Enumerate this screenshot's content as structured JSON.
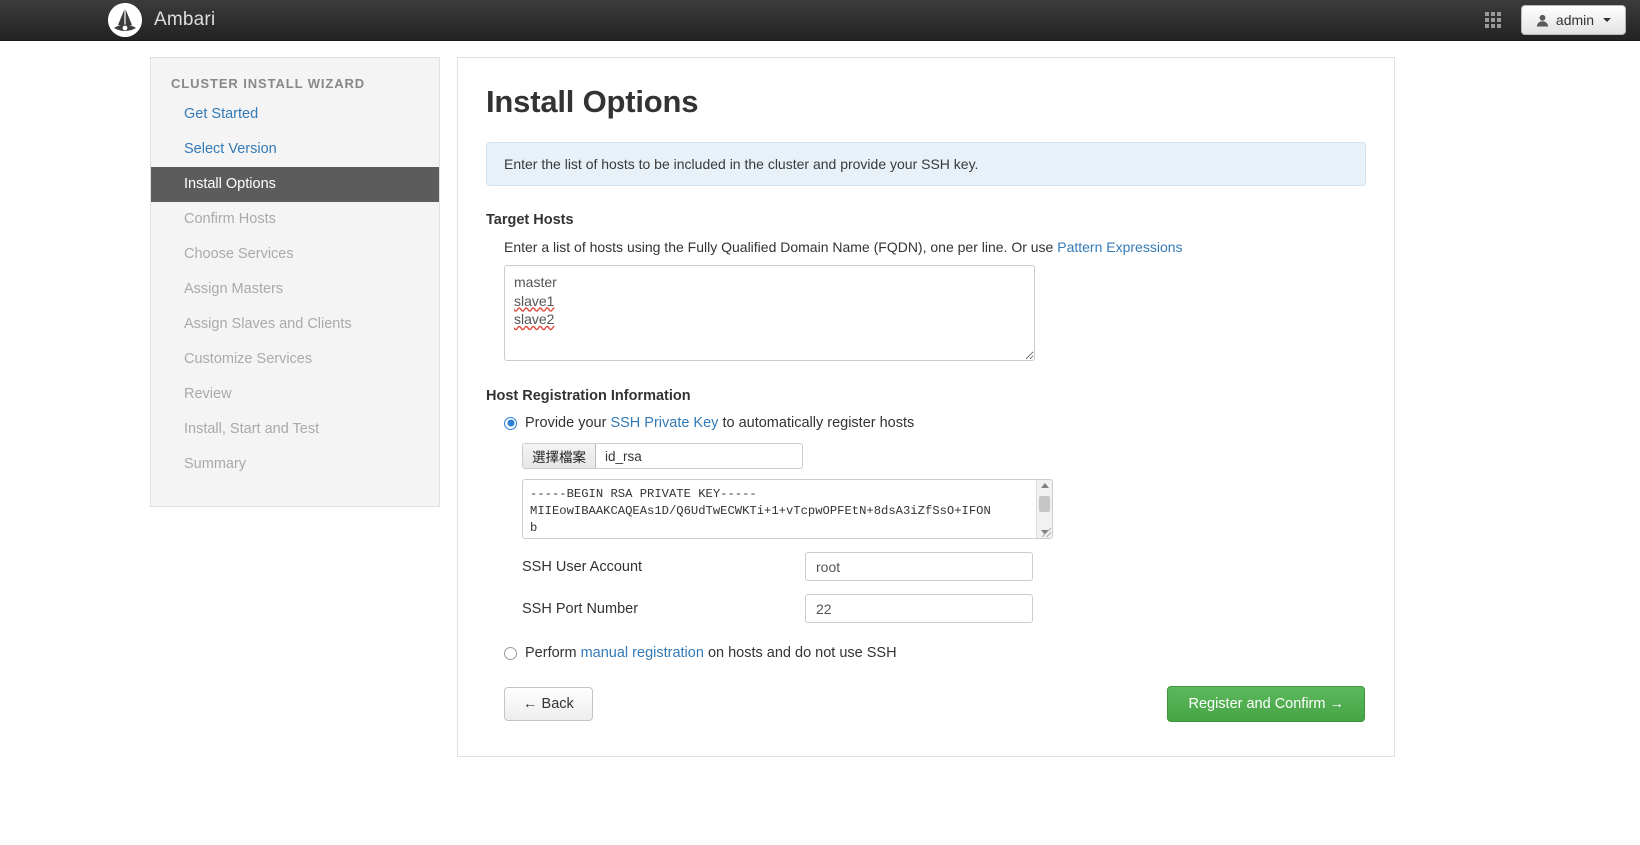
{
  "navbar": {
    "brand": "Ambari",
    "logo_icon": "ambari-logo-icon",
    "grid_icon": "grid-apps-icon",
    "user_icon": "user-icon",
    "admin_label": "admin"
  },
  "sidebar": {
    "title": "CLUSTER INSTALL WIZARD",
    "items": [
      {
        "label": "Get Started",
        "state": "done"
      },
      {
        "label": "Select Version",
        "state": "done"
      },
      {
        "label": "Install Options",
        "state": "active"
      },
      {
        "label": "Confirm Hosts",
        "state": "future"
      },
      {
        "label": "Choose Services",
        "state": "future"
      },
      {
        "label": "Assign Masters",
        "state": "future"
      },
      {
        "label": "Assign Slaves and Clients",
        "state": "future"
      },
      {
        "label": "Customize Services",
        "state": "future"
      },
      {
        "label": "Review",
        "state": "future"
      },
      {
        "label": "Install, Start and Test",
        "state": "future"
      },
      {
        "label": "Summary",
        "state": "future"
      }
    ]
  },
  "main": {
    "title": "Install Options",
    "info_banner": "Enter the list of hosts to be included in the cluster and provide your SSH key.",
    "target_hosts": {
      "label": "Target Hosts",
      "hint_prefix": "Enter a list of hosts using the Fully Qualified Domain Name (FQDN), one per line. Or use ",
      "hint_link": "Pattern Expressions",
      "hosts": [
        "master",
        "slave1",
        "slave2"
      ],
      "misspelled": [
        "slave1",
        "slave2"
      ]
    },
    "host_registration": {
      "label": "Host Registration Information",
      "ssh_option": {
        "selected": true,
        "text_before": "Provide your ",
        "link": "SSH Private Key",
        "text_after": " to automatically register hosts"
      },
      "file_picker": {
        "button_label": "選擇檔案",
        "file_name": "id_rsa"
      },
      "private_key_text": "-----BEGIN RSA PRIVATE KEY-----\nMIIEowIBAAKCAQEAs1D/Q6UdTwECWKTi+1+vTcpwOPFEtN+8dsA3iZfSsO+IFON\nb",
      "ssh_user": {
        "label": "SSH User Account",
        "value": "root"
      },
      "ssh_port": {
        "label": "SSH Port Number",
        "value": "22"
      },
      "manual_option": {
        "selected": false,
        "text_before": "Perform ",
        "link": "manual registration",
        "text_after": " on hosts and do not use SSH"
      }
    },
    "buttons": {
      "back": "← Back",
      "register": "Register and Confirm →"
    }
  },
  "colors": {
    "accent_link": "#337ab7",
    "active_step_bg": "#5c5c5c",
    "primary_button": "#5cb85c",
    "info_bg": "#e7f1f7",
    "navbar_bg": "#2c2c2c"
  }
}
